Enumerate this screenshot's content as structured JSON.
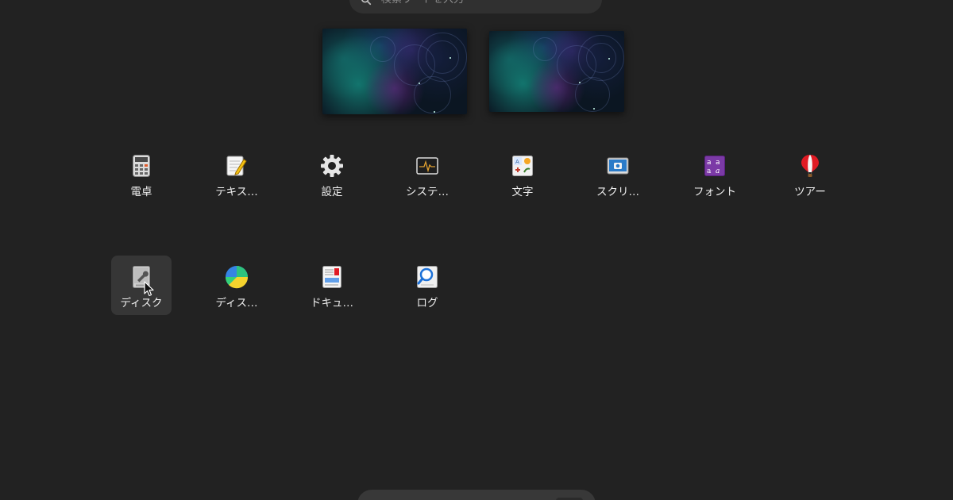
{
  "search": {
    "placeholder": "検索ワードを入力"
  },
  "workspaces": [
    {
      "id": "workspace-1"
    },
    {
      "id": "workspace-2"
    }
  ],
  "apps": [
    {
      "label": "電卓",
      "icon": "calculator-icon"
    },
    {
      "label": "テキス…",
      "icon": "text-editor-icon"
    },
    {
      "label": "設定",
      "icon": "settings-gear-icon"
    },
    {
      "label": "システ…",
      "icon": "system-monitor-icon"
    },
    {
      "label": "文字",
      "icon": "characters-icon"
    },
    {
      "label": "スクリ…",
      "icon": "screenshot-icon"
    },
    {
      "label": "フォント",
      "icon": "fonts-icon"
    },
    {
      "label": "ツアー",
      "icon": "tour-balloon-icon"
    },
    {
      "label": "ディスク",
      "icon": "disks-icon",
      "hovered": true
    },
    {
      "label": "ディス…",
      "icon": "disk-usage-icon"
    },
    {
      "label": "ドキュ…",
      "icon": "document-viewer-icon"
    },
    {
      "label": "ログ",
      "icon": "logs-icon"
    }
  ],
  "colors": {
    "background": "#222222",
    "hover": "#363636",
    "search_bg": "#303030"
  }
}
